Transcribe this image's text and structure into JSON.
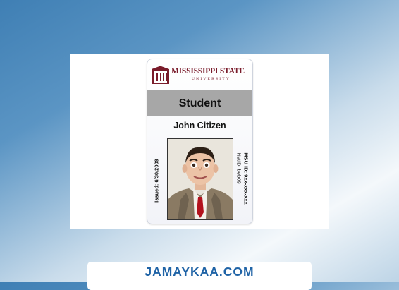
{
  "card": {
    "university_name": "MISSISSIPPI STATE",
    "university_sub": "UNIVERSITY",
    "status": "Student",
    "holder_name": "John Citizen",
    "issued": "Issued:    6/30/2009",
    "msu_id": "MSU ID: 9xx-xxx-xxx",
    "net_id": "NetID:    beb09"
  },
  "footer": {
    "site": "JAMAYKAA.COM"
  },
  "colors": {
    "maroon": "#7a1c2b",
    "status_bar": "#a7a7a7",
    "footer_text": "#1f63a6"
  }
}
